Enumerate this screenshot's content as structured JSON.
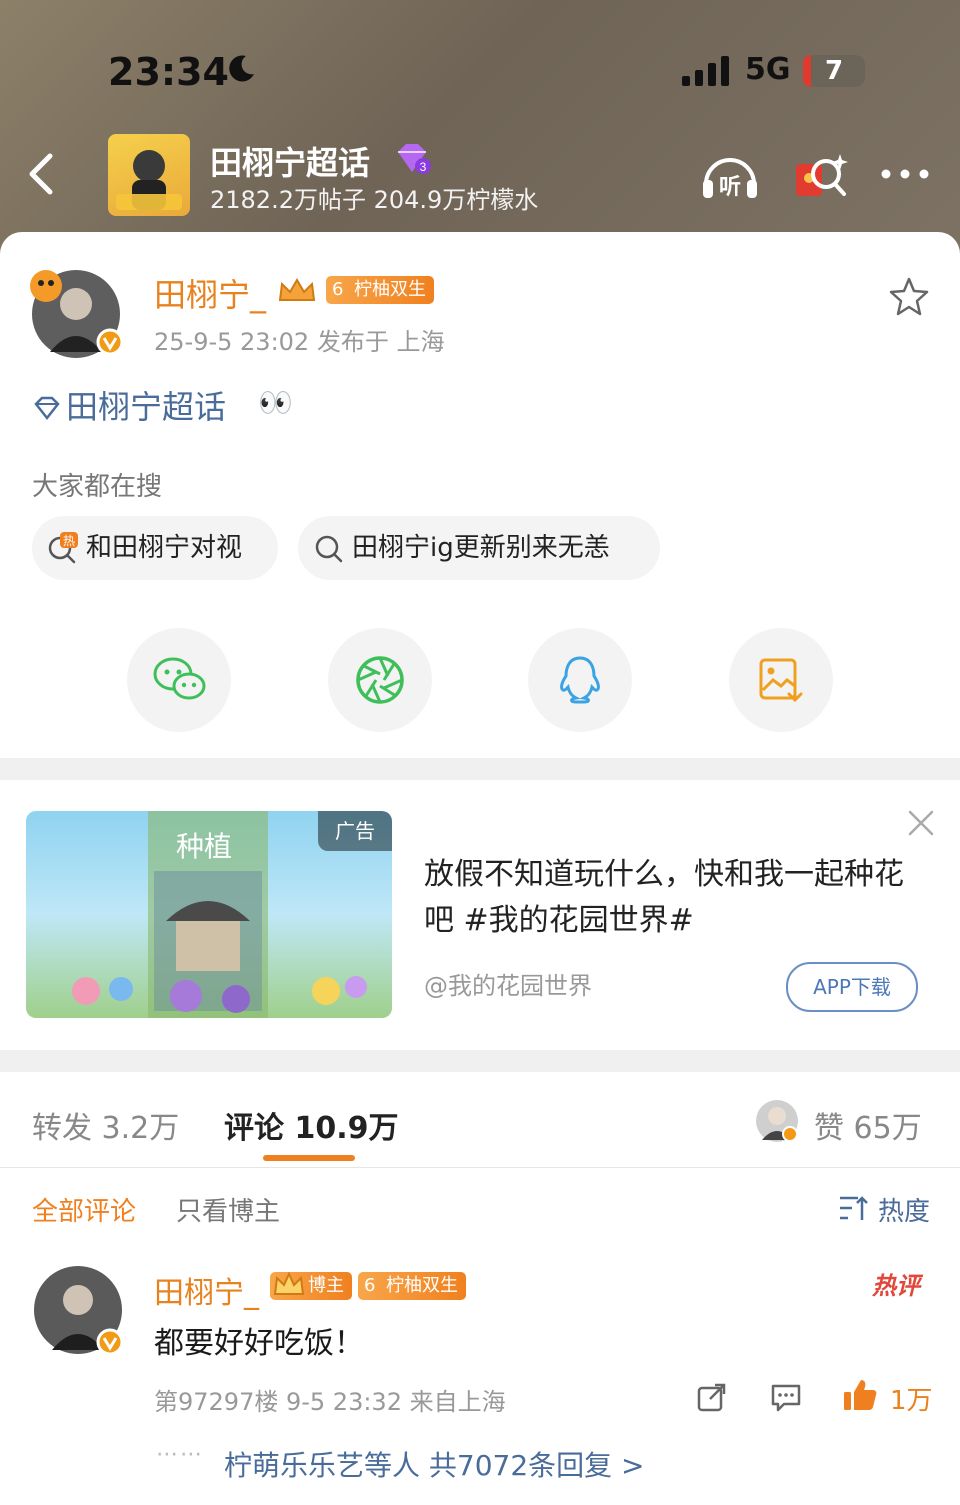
{
  "status_bar": {
    "time": "23:34",
    "network": "5G",
    "battery": "7"
  },
  "topic": {
    "title": "田栩宁超话",
    "stats": "2182.2万帖子 204.9万柠檬水",
    "level": "3",
    "listen_label": "听"
  },
  "post": {
    "author": "田栩宁_",
    "badge_level": "6",
    "badge_label": "柠柚双生",
    "meta": "25-9-5 23:02  发布于 上海",
    "topic_link": "田栩宁超话",
    "emoji": "👀",
    "search_label": "大家都在搜",
    "hot_tag": "热",
    "searches": [
      "和田栩宁对视",
      "田栩宁ig更新别来无恙"
    ]
  },
  "share": {
    "items": [
      "wechat-icon",
      "moments-icon",
      "qq-icon",
      "save-image-icon"
    ],
    "colors": [
      "#3fbf5a",
      "#3fbf5a",
      "#3aa3e3",
      "#f0a020"
    ]
  },
  "ad": {
    "tag": "广告",
    "image_title": "种植",
    "text": "放假不知道玩什么，快和我一起种花吧 #我的花园世界#",
    "source": "@我的花园世界",
    "button": "APP下载"
  },
  "tabs": {
    "repost": "转发 3.2万",
    "comments": "评论 10.9万",
    "likes": "赞 65万"
  },
  "filters": {
    "all": "全部评论",
    "author_only": "只看博主",
    "sort": "热度"
  },
  "comment": {
    "author": "田栩宁_",
    "host_badge": "博主",
    "badge_level": "6",
    "badge_label": "柠柚双生",
    "hot_label": "热评",
    "text": "都要好好吃饭！",
    "meta": "第97297楼 9-5 23:32 来自上海",
    "like_count": "1万",
    "replies": "柠萌乐乐艺等人  共7072条回复 >"
  },
  "colors": {
    "accent": "#f0801f",
    "name": "#e8821f",
    "link": "#4a6c9a",
    "hot": "#e0483b"
  }
}
